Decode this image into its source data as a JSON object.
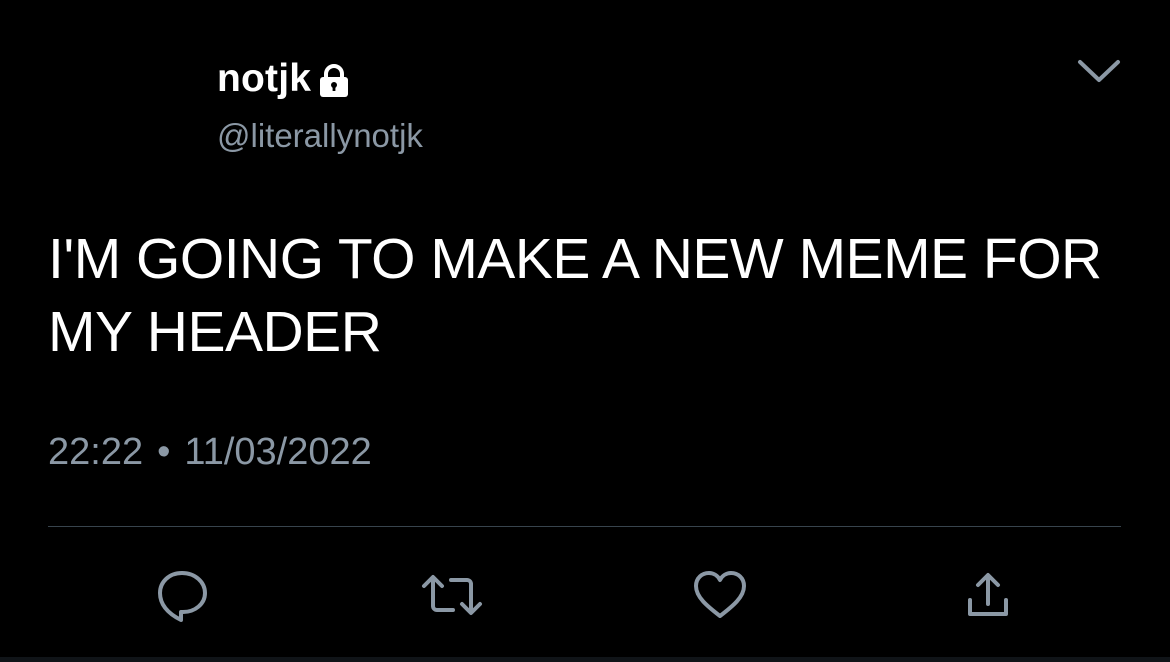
{
  "tweet": {
    "display_name": "notjk",
    "handle": "@literallynotjk",
    "protected_icon": "lock-icon",
    "text": "I'M GOING TO MAKE A NEW MEME FOR MY HEADER",
    "time": "22:22",
    "separator": "•",
    "date": "11/03/2022"
  },
  "menu": {
    "icon": "chevron-down-icon"
  },
  "actions": [
    {
      "name": "reply",
      "icon": "comment-icon"
    },
    {
      "name": "retweet",
      "icon": "retweet-icon"
    },
    {
      "name": "like",
      "icon": "heart-icon"
    },
    {
      "name": "share",
      "icon": "share-icon"
    }
  ],
  "colors": {
    "background": "#000000",
    "primary_text": "#ffffff",
    "secondary_text": "#8b98a5",
    "divider": "#38444d",
    "icon": "#8b98a5"
  }
}
